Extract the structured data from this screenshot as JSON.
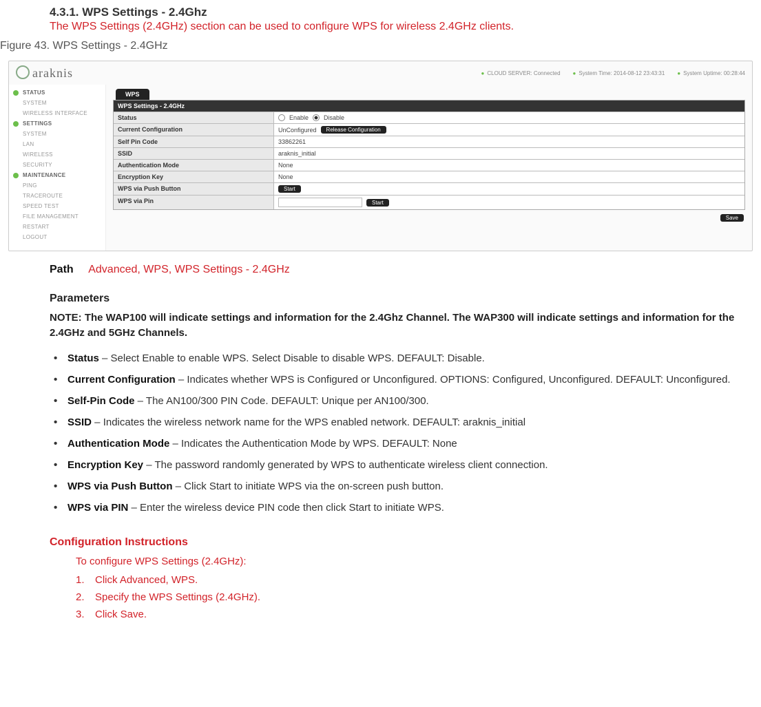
{
  "section": {
    "number_title": "4.3.1. WPS Settings - 2.4Ghz",
    "subtitle": "The WPS Settings (2.4GHz) section can be used to configure WPS for wireless 2.4GHz clients."
  },
  "figure_caption": "Figure 43. WPS Settings - 2.4GHz",
  "screenshot": {
    "brand": "araknis",
    "status": {
      "cloud": "CLOUD SERVER:  Connected",
      "time": "System Time:  2014-08-12 23:43:31",
      "uptime": "System Uptime:  00:28:44"
    },
    "nav": {
      "g1": "STATUS",
      "g1a": "SYSTEM",
      "g1b": "WIRELESS INTERFACE",
      "g2": "SETTINGS",
      "g2a": "SYSTEM",
      "g2b": "LAN",
      "g2c": "WIRELESS",
      "g2d": "SECURITY",
      "g3": "MAINTENANCE",
      "g3a": "PING",
      "g3b": "TRACEROUTE",
      "g3c": "SPEED TEST",
      "g3d": "FILE MANAGEMENT",
      "g3e": "RESTART",
      "g3f": "LOGOUT"
    },
    "tab": "WPS",
    "panel_title": "WPS Settings - 2.4GHz",
    "rows": {
      "status_l": "Status",
      "status_enable": "Enable",
      "status_disable": "Disable",
      "curr_l": "Current Configuration",
      "curr_v": "UnConfigured",
      "curr_btn": "Release Configuration",
      "pin_l": "Self Pin Code",
      "pin_v": "33862261",
      "ssid_l": "SSID",
      "ssid_v": "araknis_initial",
      "auth_l": "Authentication Mode",
      "auth_v": "None",
      "enc_l": "Encryption Key",
      "enc_v": "None",
      "push_l": "WPS via Push Button",
      "push_btn": "Start",
      "wpin_l": "WPS via Pin",
      "wpin_btn": "Start"
    },
    "save": "Save"
  },
  "path": {
    "label": "Path",
    "value": "Advanced, WPS, WPS Settings - 2.4GHz"
  },
  "params_heading": "Parameters",
  "note": "NOTE: The WAP100 will indicate settings and information for the 2.4Ghz Channel. The WAP300 will indicate settings and information for the 2.4GHz and 5GHz Channels.",
  "params": [
    {
      "b": "Status",
      "t": " – Select Enable to enable WPS. Select Disable to disable WPS. DEFAULT: Disable."
    },
    {
      "b": "Current Configuration",
      "t": " – Indicates whether WPS is Configured or Unconfigured. OPTIONS: Configured, Unconfigured. DEFAULT: Unconfigured."
    },
    {
      "b": "Self-Pin Code",
      "t": " – The AN100/300 PIN Code. DEFAULT: Unique per AN100/300."
    },
    {
      "b": "SSID",
      "t": " – Indicates the wireless network name for the WPS enabled network. DEFAULT: araknis_initial"
    },
    {
      "b": "Authentication Mode",
      "t": " – Indicates the Authentication Mode by WPS. DEFAULT: None"
    },
    {
      "b": "Encryption Key",
      "t": " – The password randomly generated by WPS to authenticate wireless client connection."
    },
    {
      "b": "WPS via Push Button",
      "t": " – Click Start to initiate WPS via the on-screen push button."
    },
    {
      "b": "WPS via PIN",
      "t": " – Enter the wireless device PIN code then click Start to initiate WPS."
    }
  ],
  "config": {
    "heading": "Configuration Instructions",
    "lead": "To configure WPS Settings (2.4GHz):",
    "steps": [
      "Click Advanced, WPS.",
      "Specify the WPS Settings (2.4GHz).",
      "Click Save."
    ]
  }
}
